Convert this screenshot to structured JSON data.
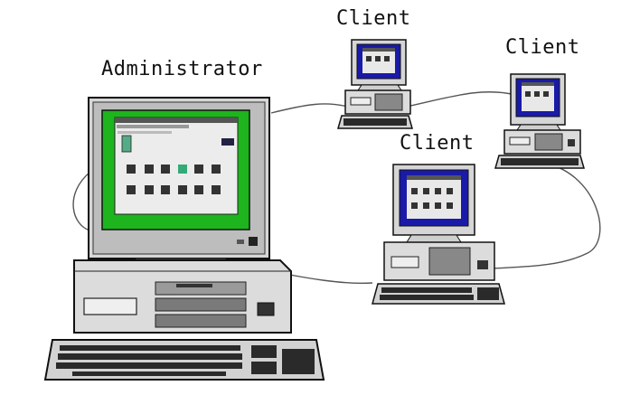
{
  "labels": {
    "administrator": "Administrator",
    "client_1": "Client",
    "client_2": "Client",
    "client_3": "Client"
  },
  "colors": {
    "admin_screen": "#1db41d",
    "client_screen": "#1a1aa8",
    "window": "#e8e8e8",
    "case": "#d8d8d8",
    "outline": "#111111",
    "network_line": "#444444"
  }
}
